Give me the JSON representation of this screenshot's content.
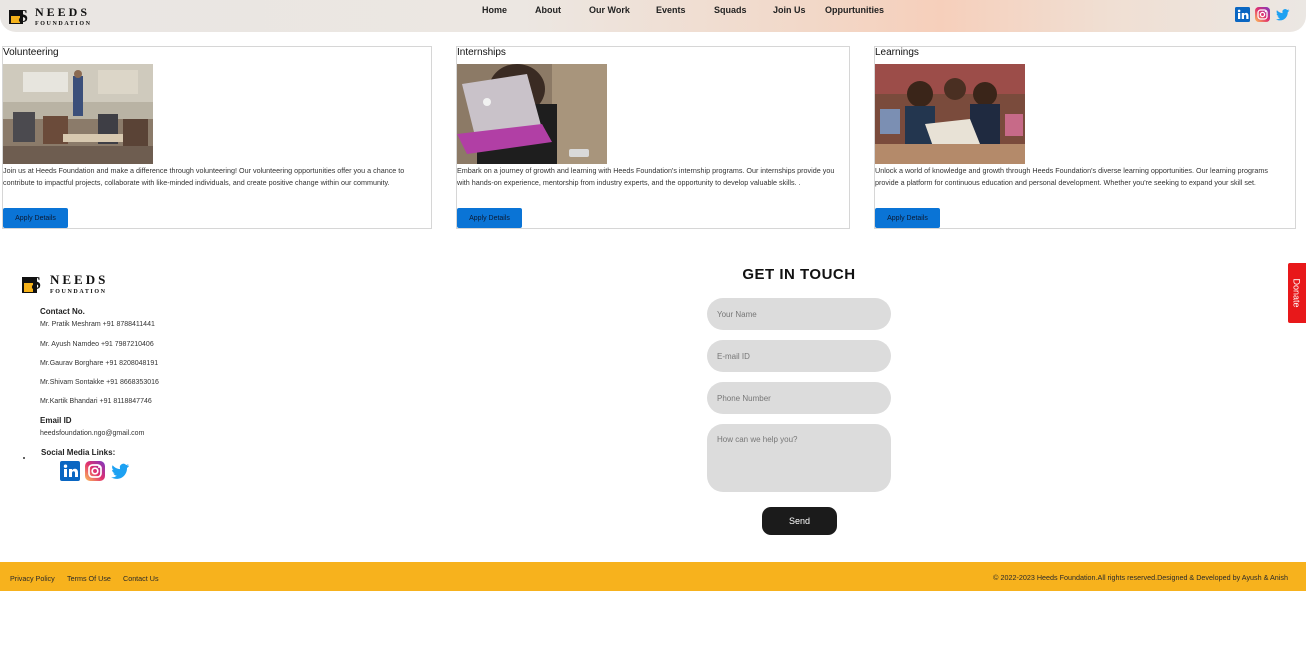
{
  "header": {
    "logo": {
      "line1": "NEEDS",
      "line2": "FOUNDATION"
    },
    "nav": [
      "Home",
      "About",
      "Our Work",
      "Events",
      "Squads",
      "Join Us",
      "Oppurtunities"
    ],
    "social_icons": [
      "linkedin-icon",
      "instagram-icon",
      "twitter-icon"
    ]
  },
  "cards": [
    {
      "title": "Volunteering",
      "image": "classroom-photo",
      "description": "Join us at Heeds Foundation and make a difference through volunteering! Our volunteering opportunities offer you a chance to contribute to impactful projects, collaborate with like-minded individuals, and create positive change within our community.",
      "button": "Apply Details"
    },
    {
      "title": "Internships",
      "image": "laptop-photo",
      "description": "Embark on a journey of growth and learning with Heeds Foundation's internship programs. Our internships provide you with hands-on experience, mentorship from industry experts, and the opportunity to develop valuable skills. .",
      "button": "Apply Details"
    },
    {
      "title": "Learnings",
      "image": "children-reading-photo",
      "description": "Unlock a world of knowledge and growth through Heeds Foundation's diverse learning opportunities. Our learning programs provide a platform for continuous education and personal development. Whether you're seeking to expand your skill set.",
      "button": "Apply Details"
    }
  ],
  "contact": {
    "logo": {
      "line1": "NEEDS",
      "line2": "FOUNDATION"
    },
    "contact_heading": "Contact No.",
    "phones": [
      "Mr. Pratik Meshram +91 8788411441",
      "Mr. Ayush Namdeo +91 7987210406",
      "Mr.Gaurav Borghare +91 8208048191",
      "Mr.Shivam Sontakke +91 8668353016",
      "Mr.Kartik Bhandari +91 8118847746"
    ],
    "email_heading": "Email ID",
    "email": "heedsfoundation.ngo@gmail.com",
    "social_heading": "Social Media Links:",
    "social_icons": [
      "linkedin-icon",
      "instagram-icon",
      "twitter-icon"
    ]
  },
  "form": {
    "heading": "GET IN TOUCH",
    "name_placeholder": "Your Name",
    "email_placeholder": "E-mail ID",
    "phone_placeholder": "Phone Number",
    "message_placeholder": "How can we help you?",
    "send_label": "Send"
  },
  "donate_label": "Donate",
  "footer": {
    "links": [
      "Privacy Policy",
      "Terms Of Use",
      "Contact Us"
    ],
    "copyright": "© 2022-2023 Heeds Foundation.All rights reserved.Designed & Developed by Ayush & Anish"
  },
  "colors": {
    "button_blue": "#0a74d6",
    "footer_yellow": "#f7b21d",
    "donate_red": "#e8181a",
    "send_black": "#1b1b1b"
  }
}
